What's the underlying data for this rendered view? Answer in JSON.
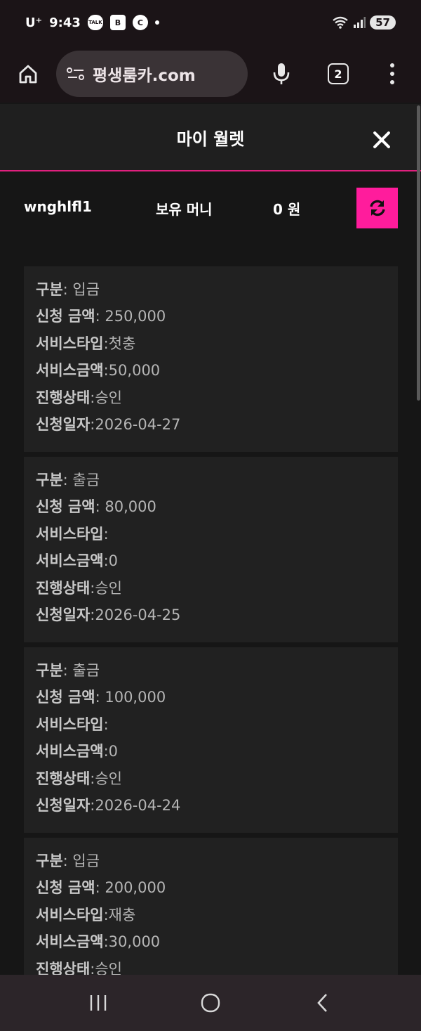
{
  "status_bar": {
    "carrier": "U⁺",
    "time": "9:43",
    "app_icons": [
      "TALK",
      "B",
      "C"
    ],
    "battery": "57"
  },
  "browser": {
    "url": "평생룸카.com",
    "tab_count": "2"
  },
  "wallet": {
    "title": "마이 월렛",
    "username": "wnghlfl1",
    "money_label": "보유 머니",
    "money_value": "0 원"
  },
  "labels": {
    "type": "구분",
    "amount": "신청 금액",
    "service_type": "서비스타입",
    "service_amount": "서비스금액",
    "status": "진행상태",
    "date": "신청일자"
  },
  "transactions": [
    {
      "type": ": 입금",
      "amount": ": 250,000",
      "service_type": ":첫충",
      "service_amount": ":50,000",
      "status": ":승인",
      "date": ":2026-04-27"
    },
    {
      "type": ": 출금",
      "amount": ": 80,000",
      "service_type": ":",
      "service_amount": ":0",
      "status": ":승인",
      "date": ":2026-04-25"
    },
    {
      "type": ": 출금",
      "amount": ": 100,000",
      "service_type": ":",
      "service_amount": ":0",
      "status": ":승인",
      "date": ":2026-04-24"
    },
    {
      "type": ": 입금",
      "amount": ": 200,000",
      "service_type": ":재충",
      "service_amount": ":30,000",
      "status": ":승인",
      "date": ""
    }
  ],
  "colors": {
    "accent": "#ff1c9c",
    "divider": "#e0207e",
    "card_bg": "#212121",
    "page_bg": "#161616"
  }
}
